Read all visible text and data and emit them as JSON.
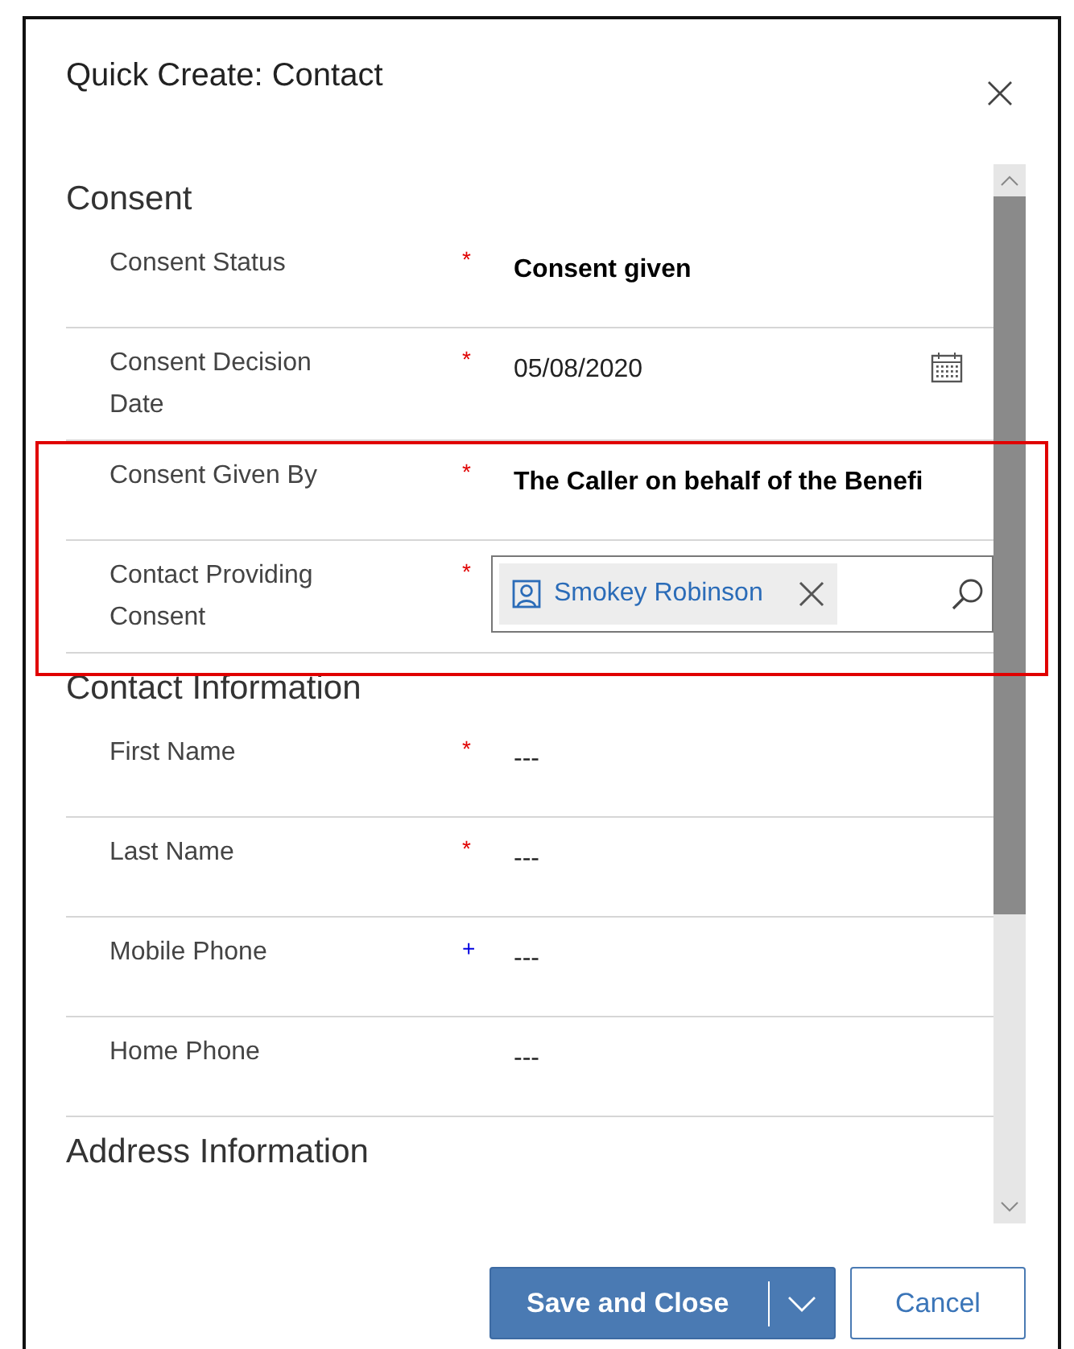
{
  "dialog": {
    "title": "Quick Create: Contact"
  },
  "sections": [
    {
      "title": "Consent",
      "fields": [
        {
          "label": "Consent Status",
          "mark": "*",
          "color": "#e00000",
          "kind": "option",
          "value": "Consent given"
        },
        {
          "label": "Consent Decision Date",
          "mark": "*",
          "color": "#e00000",
          "kind": "date",
          "value": "05/08/2020"
        },
        {
          "label": "Consent Given By",
          "mark": "*",
          "color": "#e00000",
          "kind": "option",
          "value": "The Caller on behalf of the Benefi"
        },
        {
          "label": "Contact Providing Consent",
          "mark": "*",
          "color": "#e00000",
          "kind": "lookup",
          "value": "Smokey Robinson"
        }
      ]
    },
    {
      "title": "Contact Information",
      "fields": [
        {
          "label": "First Name",
          "mark": "*",
          "color": "#e00000",
          "kind": "text",
          "value": "---"
        },
        {
          "label": "Last Name",
          "mark": "*",
          "color": "#e00000",
          "kind": "text",
          "value": "---"
        },
        {
          "label": "Mobile Phone",
          "mark": "+",
          "color": "#0000e0",
          "kind": "text",
          "value": "---"
        },
        {
          "label": "Home Phone",
          "kind": "text",
          "value": "---"
        }
      ]
    },
    {
      "title": "Address Information"
    }
  ],
  "buttons": [
    {
      "label": "Save and Close",
      "kind": "primary"
    },
    {
      "label": "Cancel",
      "kind": "secondary"
    }
  ]
}
